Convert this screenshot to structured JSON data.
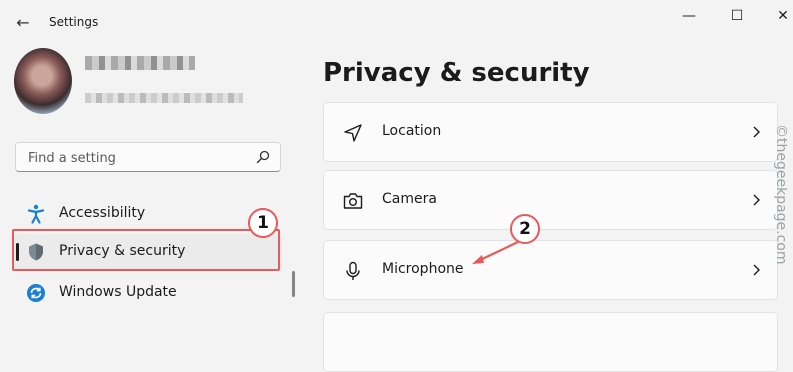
{
  "window": {
    "title": "Settings",
    "back_glyph": "←",
    "minimize_glyph": "—",
    "maximize_glyph": "☐",
    "close_glyph": "✕"
  },
  "profile": {
    "avatar": "user-avatar-pixelated",
    "name_blurred": true,
    "email_blurred": true
  },
  "search": {
    "placeholder": "Find a setting",
    "value": ""
  },
  "sidebar": {
    "items": [
      {
        "label": "Accessibility",
        "icon": "accessibility-icon",
        "selected": false
      },
      {
        "label": "Privacy & security",
        "icon": "shield-icon",
        "selected": true
      },
      {
        "label": "Windows Update",
        "icon": "windows-update-icon",
        "selected": false
      }
    ]
  },
  "main": {
    "title": "Privacy & security",
    "cards": [
      {
        "label": "Location",
        "icon": "location-arrow-icon"
      },
      {
        "label": "Camera",
        "icon": "camera-icon"
      },
      {
        "label": "Microphone",
        "icon": "microphone-icon"
      }
    ]
  },
  "annotations": {
    "callout_1": "1",
    "callout_2": "2",
    "accent_color": "#e65a5a",
    "watermark": "©thegeekpage.com"
  }
}
